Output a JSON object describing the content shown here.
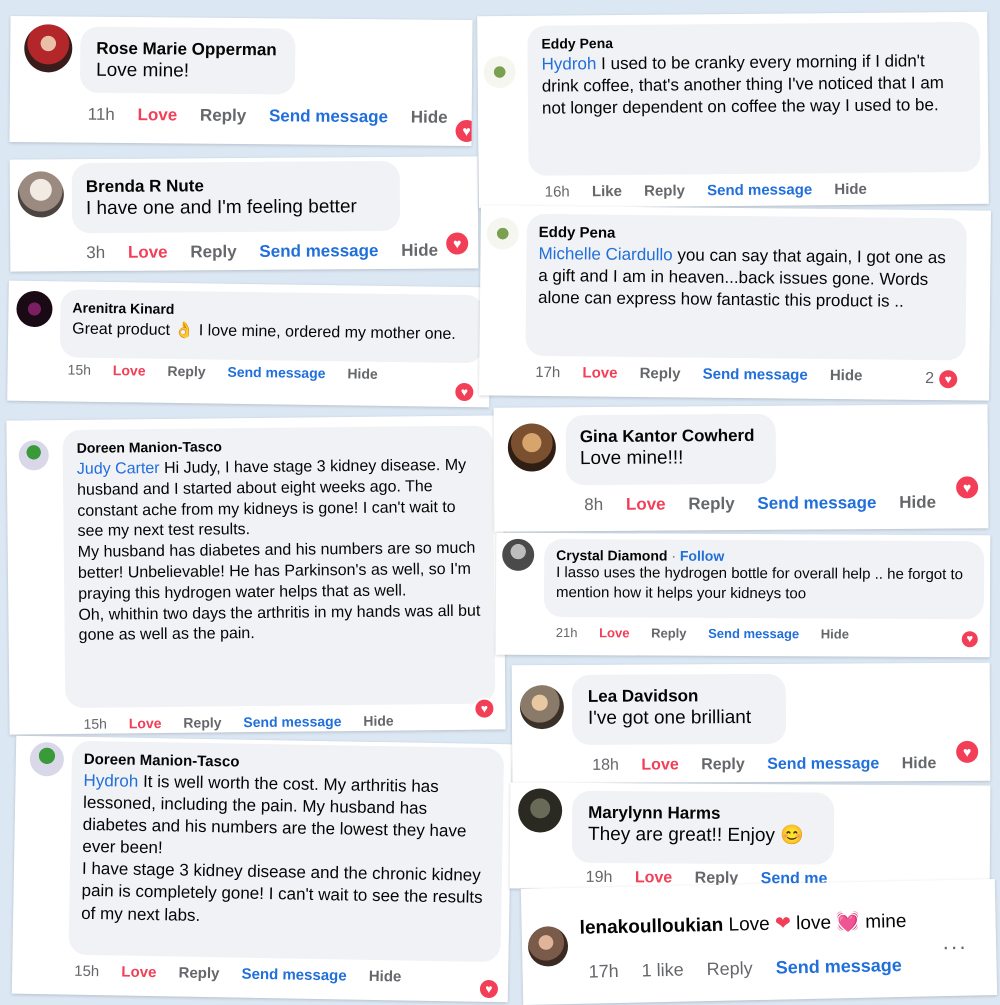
{
  "actions": {
    "love": "Love",
    "like": "Like",
    "reply": "Reply",
    "send_message": "Send message",
    "send_message_cut": "Send me",
    "hide": "Hide"
  },
  "comments": [
    {
      "name": "Rose Marie Opperman",
      "text": "Love mine!",
      "time": "11h"
    },
    {
      "name": "Brenda R Nute",
      "text": "I have one and I'm feeling better",
      "time": "3h"
    },
    {
      "name": "Arenitra Kinard",
      "text_before": "Great product",
      "emoji": "👌",
      "text_after": "I love mine, ordered my mother one.",
      "time": "15h"
    },
    {
      "name": "Doreen Manion-Tasco",
      "tag": "Judy Carter",
      "text": "Hi Judy, I have stage 3 kidney disease. My husband and I started about eight weeks ago. The constant ache from my kidneys is gone! I can't wait to see my next test results.",
      "text2": "My husband has diabetes and his numbers are so much better! Unbelievable! He has Parkinson's as well, so I'm praying this hydrogen water helps that as well.",
      "text3": "Oh, whithin two days the arthritis in my hands was all but gone as well as the pain.",
      "time": "15h"
    },
    {
      "name": "Doreen Manion-Tasco",
      "tag": "Hydroh",
      "text": "It is well worth the cost. My arthritis has lessoned, including the pain. My husband has diabetes and his numbers are the lowest they have ever been!",
      "text2": "I have stage 3 kidney disease and the chronic kidney pain is completely gone! I can't wait to see the results of my next labs.",
      "time": "15h"
    },
    {
      "name": "Eddy Pena",
      "tag": "Hydroh",
      "text": "I used to be cranky every morning if I didn't drink coffee, that's another thing I've noticed that I am not longer dependent on coffee the way I used to be.",
      "time": "16h"
    },
    {
      "name": "Eddy Pena",
      "tag": "Michelle Ciardullo",
      "text": "you can say that again, I got one as a gift and I am in heaven...back issues gone. Words alone can express how fantastic this product is ..",
      "time": "17h",
      "reaction_count": "2"
    },
    {
      "name": "Gina Kantor Cowherd",
      "text": "Love mine!!!",
      "time": "8h"
    },
    {
      "name": "Crystal Diamond",
      "follow": "Follow",
      "text": "I lasso uses the hydrogen bottle for overall help .. he forgot to mention how it helps your kidneys too",
      "time": "21h"
    },
    {
      "name": "Lea Davidson",
      "text": "I've got one brilliant",
      "time": "18h"
    },
    {
      "name": "Marylynn Harms",
      "text": "They are great!! Enjoy",
      "emoji": "😊",
      "time": "19h"
    },
    {
      "name": "lenakoulloukian",
      "text_a": "Love",
      "text_b": "love",
      "text_c": "mine",
      "time": "17h",
      "likes": "1 like",
      "more": "···"
    }
  ],
  "colors": {
    "background": "#dbe7f3",
    "bubble": "#f0f2f5",
    "love": "#f33e58",
    "link": "#216fdb",
    "meta": "#65676b"
  }
}
